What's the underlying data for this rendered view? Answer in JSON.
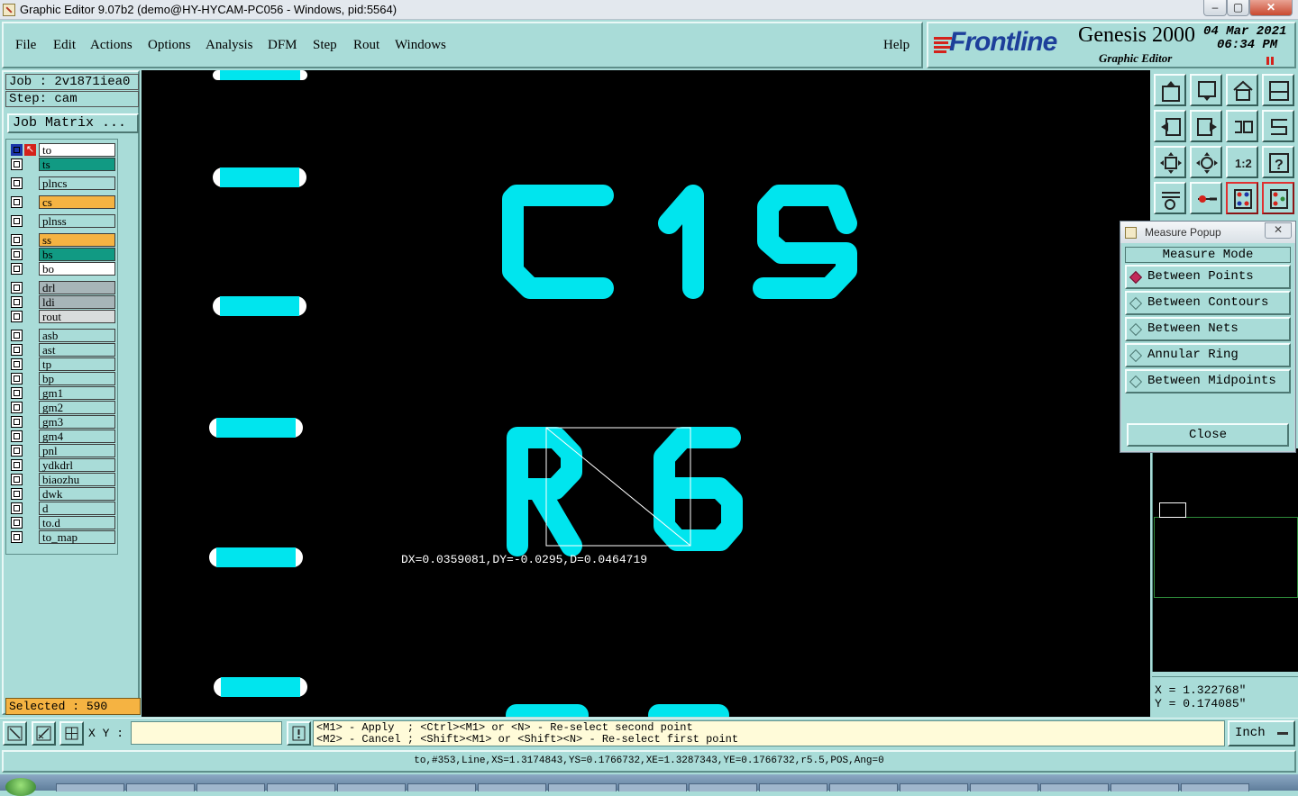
{
  "window": {
    "title": "Graphic Editor 9.07b2 (demo@HY-HYCAM-PC056 - Windows, pid:5564)",
    "minimize": "–",
    "maximize": "▢",
    "close": "✕"
  },
  "menu": {
    "items": [
      "File",
      "Edit",
      "Actions",
      "Options",
      "Analysis",
      "DFM",
      "Step",
      "Rout",
      "Windows"
    ],
    "help": "Help"
  },
  "brand": {
    "logo": "Frontline",
    "product": "Genesis 2000",
    "subtitle": "Graphic Editor",
    "date": "04 Mar 2021",
    "time": "06:34 PM"
  },
  "job": {
    "job_label": "Job : 2v1871iea0",
    "step_label": "Step: cam",
    "matrix_button": "Job Matrix ..."
  },
  "layers": [
    {
      "name": "to",
      "color": "#ffffff",
      "work": true
    },
    {
      "name": "ts",
      "color": "#119a83"
    },
    {
      "name": "plncs",
      "color": "#a9dcd8"
    },
    {
      "name": "cs",
      "color": "#f5b342"
    },
    {
      "name": "plnss",
      "color": "#a9dcd8"
    },
    {
      "name": "ss",
      "color": "#f5b342"
    },
    {
      "name": "bs",
      "color": "#119a83"
    },
    {
      "name": "bo",
      "color": "#ffffff"
    },
    {
      "name": "drl",
      "color": "#a7b5b8"
    },
    {
      "name": "ldi",
      "color": "#a7b5b8"
    },
    {
      "name": "rout",
      "color": "#d8dcdc"
    },
    {
      "name": "asb",
      "color": "#a9dcd8"
    },
    {
      "name": "ast",
      "color": "#a9dcd8"
    },
    {
      "name": "tp",
      "color": "#a9dcd8"
    },
    {
      "name": "bp",
      "color": "#a9dcd8"
    },
    {
      "name": "gm1",
      "color": "#a9dcd8"
    },
    {
      "name": "gm2",
      "color": "#a9dcd8"
    },
    {
      "name": "gm3",
      "color": "#a9dcd8"
    },
    {
      "name": "gm4",
      "color": "#a9dcd8"
    },
    {
      "name": "pnl",
      "color": "#a9dcd8"
    },
    {
      "name": "ydkdrl",
      "color": "#a9dcd8"
    },
    {
      "name": "biaozhu",
      "color": "#a9dcd8"
    },
    {
      "name": "dwk",
      "color": "#a9dcd8"
    },
    {
      "name": "d",
      "color": "#a9dcd8"
    },
    {
      "name": "to.d",
      "color": "#a9dcd8"
    },
    {
      "name": "to_map",
      "color": "#a9dcd8"
    }
  ],
  "selected": "Selected : 590",
  "canvas": {
    "label_top": "C19",
    "label_mid": "R6",
    "measure_result": "DX=0.0359081,DY=-0.0295,D=0.0464719",
    "trace_color": "#00e5ee"
  },
  "measure_popup": {
    "title": "Measure Popup",
    "header": "Measure Mode",
    "options": [
      "Between Points",
      "Between Contours",
      "Between Nets",
      "Annular Ring",
      "Between Midpoints"
    ],
    "selected_option": "Between Points",
    "close": "Close"
  },
  "coords": {
    "x": "X = 1.322768\"",
    "y": "Y = 0.174085\""
  },
  "toolbar_icons": [
    "home-up-icon",
    "down-icon",
    "home-icon",
    "window-split-icon",
    "move-left-icon",
    "move-right-icon",
    "rotate-icon",
    "step-icon",
    "zoom-fit-icon",
    "zoom-center-icon",
    "scale-1-2-icon",
    "help-query-icon",
    "wrench-icon",
    "probe-icon",
    "net-left-icon",
    "net-right-icon"
  ],
  "bottom": {
    "xy_label": "X Y :",
    "xy_value": "",
    "hint_line1": "<M1> - Apply  ; <Ctrl><M1> or <N> - Re-select second point",
    "hint_line2": "<M2> - Cancel ; <Shift><M1> or <Shift><N> - Re-select first point",
    "unit": "Inch"
  },
  "status": "to,#353,Line,XS=1.3174843,YS=0.1766732,XE=1.3287343,YE=0.1766732,r5.5,POS,Ang=0"
}
